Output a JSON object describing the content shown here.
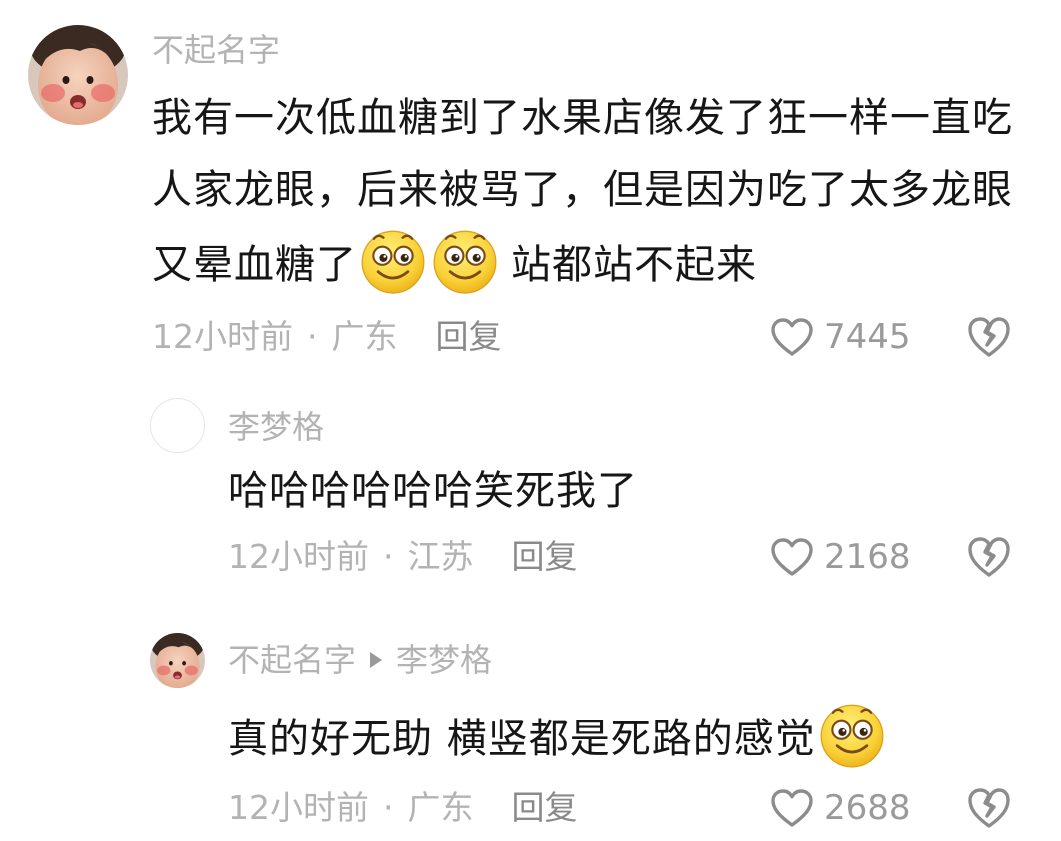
{
  "comments": [
    {
      "username": "不起名字",
      "content_lines": [
        "我有一次低血糖到了水果店像发了狂一样一直吃",
        "人家龙眼，后来被骂了，但是因为吃了太多龙眼"
      ],
      "content_last_before": "又晕血糖了",
      "content_last_after": "站都站不起来",
      "emojis": [
        "smile-emoji",
        "smile-emoji"
      ],
      "time": "12小时前",
      "location": "广东",
      "reply_label": "回复",
      "likes": "7445",
      "avatar": "avatar-child-photo"
    },
    {
      "username": "李梦格",
      "content": "哈哈哈哈哈哈笑死我了",
      "time": "12小时前",
      "location": "江苏",
      "reply_label": "回复",
      "likes": "2168",
      "avatar": "avatar-blank"
    },
    {
      "username": "不起名字",
      "reply_to": "李梦格",
      "content": "真的好无助 横竖都是死路的感觉",
      "emojis": [
        "smile-emoji"
      ],
      "time": "12小时前",
      "location": "广东",
      "reply_label": "回复",
      "likes": "2688",
      "avatar": "avatar-child-photo"
    }
  ],
  "separator": "·",
  "colors": {
    "text": "#161616",
    "muted": "#b3b3b3",
    "icon": "#8c8c8c",
    "emoji": "#f7cc33"
  }
}
